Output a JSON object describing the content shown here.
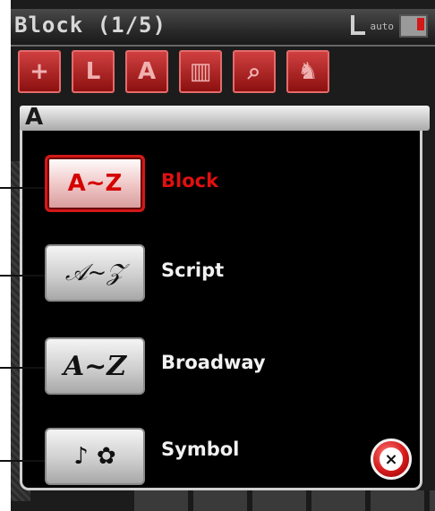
{
  "status_bar": {
    "title": "Block (1/5)",
    "auto_label": "auto",
    "foot_icon": "presser-foot-icon",
    "bobbin_icon": "bobbin-icon"
  },
  "toolbar": {
    "items": [
      {
        "icon": "needle-plus-icon",
        "glyph": "+"
      },
      {
        "icon": "mirror-letter-icon",
        "glyph": "L"
      },
      {
        "icon": "letter-a-icon",
        "glyph": "A"
      },
      {
        "icon": "building-icon",
        "glyph": "▥"
      },
      {
        "icon": "magnifier-icon",
        "glyph": "⌕"
      },
      {
        "icon": "bag-icon",
        "glyph": "♞"
      }
    ]
  },
  "dialog": {
    "header_glyph": "A",
    "options": [
      {
        "button_text": "A~Z",
        "label": "Block",
        "selected": true
      },
      {
        "button_text": "𝒜~𝒵",
        "label": "Script",
        "selected": false
      },
      {
        "button_text": "A~Z",
        "label": "Broadway",
        "selected": false
      },
      {
        "button_text": "♪ ✿",
        "label": "Symbol",
        "selected": false
      }
    ],
    "close_symbol": "×"
  },
  "colors": {
    "accent_red": "#d21818",
    "selected_label": "#e01010",
    "text": "#f2f2f2"
  }
}
